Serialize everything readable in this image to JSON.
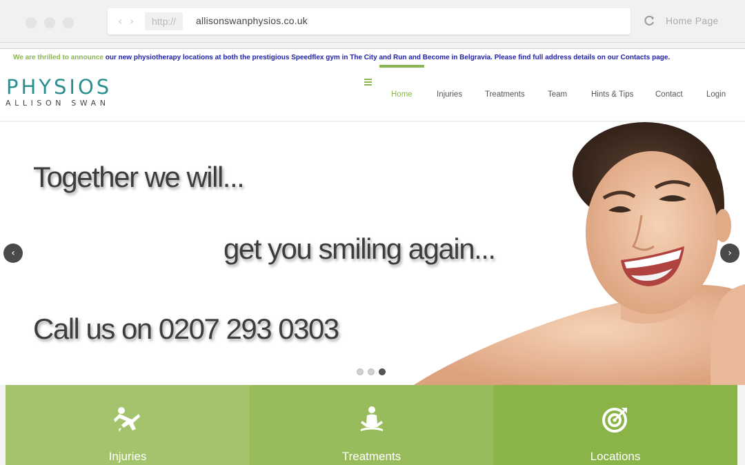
{
  "browser": {
    "protocol": "http://",
    "url": "allisonswanphysios.co.uk",
    "home_label": "Home Page"
  },
  "announcement": {
    "highlight": "We are thrilled to announce",
    "text": " our new physiotherapy locations at both the prestigious Speedflex gym in The City and Run and Become in Belgravia. Please find full address details on our Contacts page."
  },
  "logo": {
    "main": "PHYSIOS",
    "sub": "ALLISON SWAN"
  },
  "nav": {
    "items": [
      "Home",
      "Injuries",
      "Treatments",
      "Team",
      "Hints & Tips",
      "Contact",
      "Login"
    ],
    "active": "Home"
  },
  "hero": {
    "line1": "Together we will...",
    "line2": "get you smiling again...",
    "line3": "Call us on 0207 293 0303",
    "slide_count": 3,
    "active_slide": 3
  },
  "tiles": [
    {
      "label": "Injuries",
      "icon": "falling-person-icon",
      "color": "#a3c46d"
    },
    {
      "label": "Treatments",
      "icon": "meditation-icon",
      "color": "#98bb5c"
    },
    {
      "label": "Locations",
      "icon": "target-icon",
      "color": "#8bb448"
    }
  ],
  "colors": {
    "accent": "#8cb453",
    "logo": "#2c8f8f",
    "announce_link": "#1f1fa8"
  }
}
